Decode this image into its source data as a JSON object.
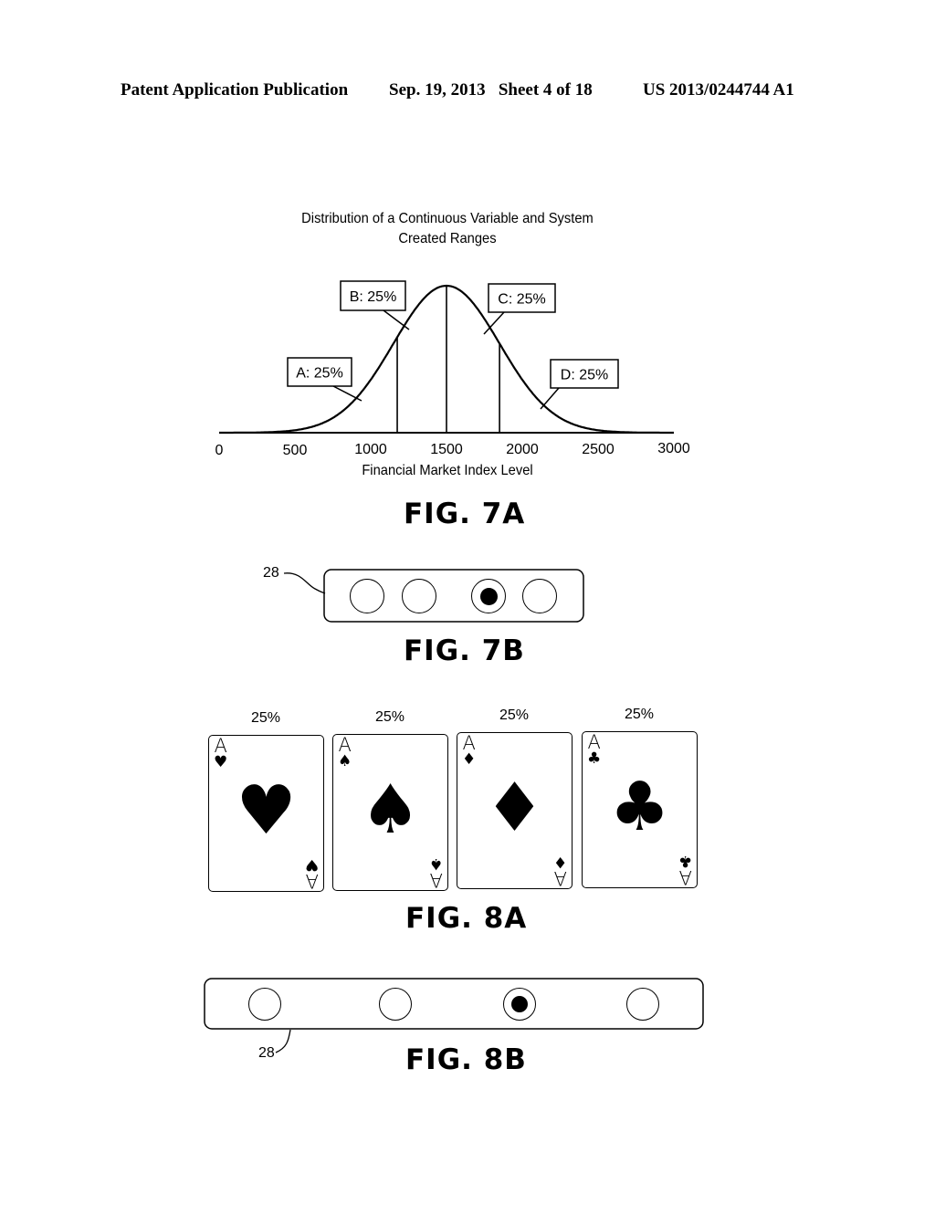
{
  "header": {
    "left": "Patent Application Publication",
    "middle": "Sep. 19, 2013   Sheet 4 of 18",
    "right": "US 2013/0244744 A1"
  },
  "fig7a": {
    "label": "FIG. 7A",
    "chart_data": {
      "type": "line",
      "title": "Distribution of a Continuous Variable and System Created Ranges",
      "title_lines": [
        "Distribution of a Continuous Variable and System",
        "Created Ranges"
      ],
      "xlabel": "Financial Market Index Level",
      "ylabel": "",
      "xlim": [
        0,
        3000
      ],
      "xticks": [
        "0",
        "500",
        "1000",
        "1500",
        "2000",
        "2500",
        "3000"
      ],
      "distribution": "normal",
      "mean": 1500,
      "std": 350,
      "range_boundaries": [
        1175,
        1500,
        1850
      ],
      "annotations": [
        {
          "label": "A: 25%",
          "range": "0-1175",
          "share": 25
        },
        {
          "label": "B: 25%",
          "range": "1175-1500",
          "share": 25
        },
        {
          "label": "C: 25%",
          "range": "1500-1850",
          "share": 25
        },
        {
          "label": "D: 25%",
          "range": "1850-3000",
          "share": 25
        }
      ],
      "grid": false,
      "legend": "none"
    }
  },
  "fig7b": {
    "label": "FIG. 7B",
    "ref": "28",
    "options": [
      {
        "name": "option-1",
        "selected": false
      },
      {
        "name": "option-2",
        "selected": false
      },
      {
        "name": "option-3",
        "selected": true
      },
      {
        "name": "option-4",
        "selected": false
      }
    ]
  },
  "fig8a": {
    "label": "FIG. 8A",
    "cards": [
      {
        "rank": "A",
        "suit": "hearts",
        "glyph": "♥",
        "percent": "25%"
      },
      {
        "rank": "A",
        "suit": "spades",
        "glyph": "♠",
        "percent": "25%"
      },
      {
        "rank": "A",
        "suit": "diamonds",
        "glyph": "♦",
        "percent": "25%"
      },
      {
        "rank": "A",
        "suit": "clubs",
        "glyph": "♣",
        "percent": "25%"
      }
    ]
  },
  "fig8b": {
    "label": "FIG. 8B",
    "ref": "28",
    "options": [
      {
        "name": "option-1",
        "selected": false
      },
      {
        "name": "option-2",
        "selected": false
      },
      {
        "name": "option-3",
        "selected": true
      },
      {
        "name": "option-4",
        "selected": false
      }
    ]
  }
}
